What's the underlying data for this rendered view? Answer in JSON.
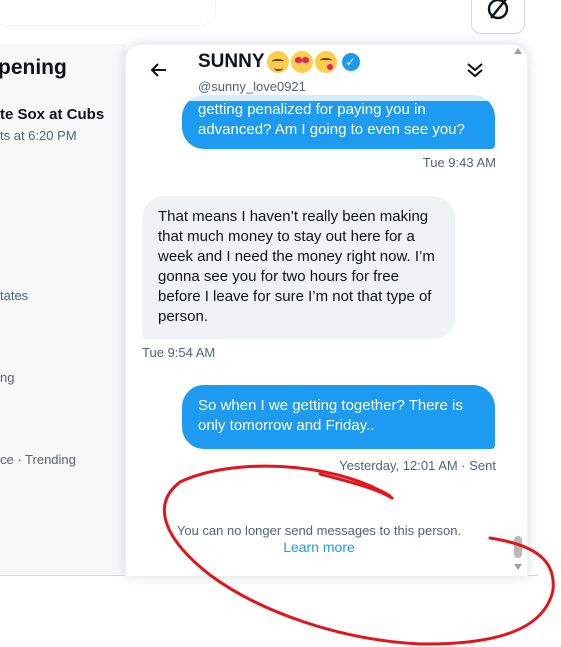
{
  "background": {
    "trends_title": "pening",
    "trend_name": "te Sox at Cubs",
    "trend_sub": "ts at 6:20 PM",
    "meta1": "tates",
    "meta2": "ng",
    "meta3": "ce · Trending"
  },
  "dm": {
    "name": "SUNNY",
    "handle": "@sunny_love0921",
    "messages": [
      {
        "dir": "sent",
        "text": "getting penalized for paying you in advanced?  Am I going to even see you?"
      },
      {
        "dir": "recv",
        "text": "That means I haven’t really been making that much money to stay out here for a week and I need the money right now. I’m gonna see you for two hours for free before I leave for sure I’m not that type of person."
      },
      {
        "dir": "sent",
        "text": "So when I we getting together?  There is only tomorrow and Friday.."
      }
    ],
    "timestamps": [
      "Tue 9:43 AM",
      "Tue 9:54 AM",
      "Yesterday, 12:01 AM · Sent"
    ],
    "notice": "You can no longer send messages to this person.",
    "learn_more": "Learn more"
  },
  "colors": {
    "accent": "#1d9bf0",
    "annotation": "#e0161b"
  },
  "icons": [
    "back-arrow-icon",
    "verified-badge-icon",
    "collapse-chevron-icon",
    "grok-icon"
  ]
}
